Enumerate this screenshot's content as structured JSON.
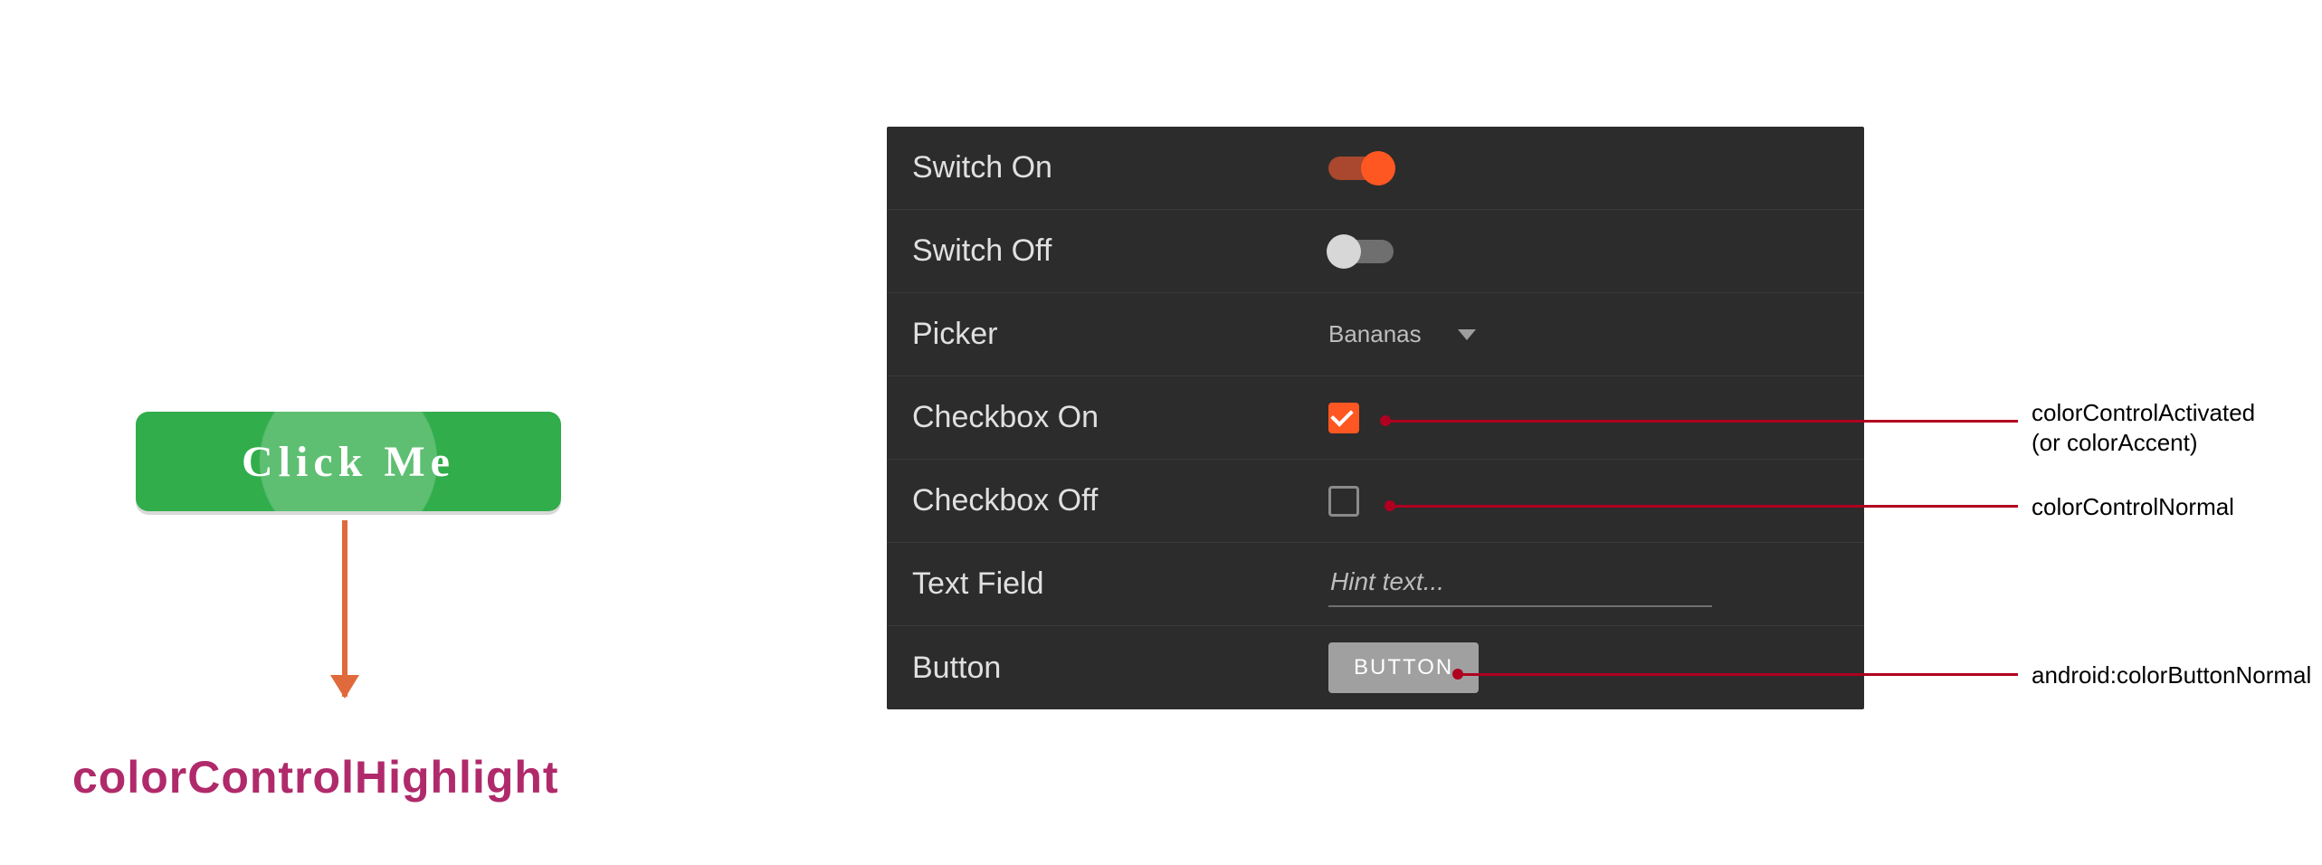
{
  "left": {
    "button_label": "Click Me",
    "annotation": "colorControlHighlight"
  },
  "panel": {
    "rows": {
      "switch_on": {
        "label": "Switch On"
      },
      "switch_off": {
        "label": "Switch Off"
      },
      "picker": {
        "label": "Picker",
        "value": "Bananas"
      },
      "checkbox_on": {
        "label": "Checkbox On"
      },
      "checkbox_off": {
        "label": "Checkbox Off"
      },
      "text_field": {
        "label": "Text Field",
        "placeholder": "Hint text..."
      },
      "button": {
        "label": "Button",
        "button_text": "BUTTON"
      }
    }
  },
  "callouts": {
    "activated_line1": "colorControlActivated",
    "activated_line2": "(or colorAccent)",
    "normal": "colorControlNormal",
    "button_normal": "android:colorButtonNormal"
  },
  "colors": {
    "accent": "#ff5722",
    "button_bg": "#31ad4b",
    "annotation_line": "#b00020",
    "highlight_text": "#b02a6b"
  }
}
